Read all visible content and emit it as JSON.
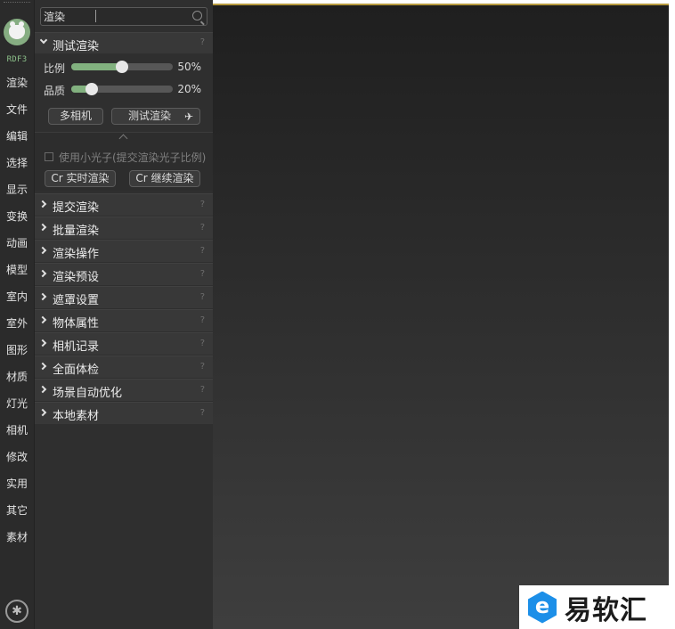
{
  "nav": {
    "version": "RDF3",
    "items": [
      "渲染",
      "文件",
      "编辑",
      "选择",
      "显示",
      "变换",
      "动画",
      "模型",
      "室内",
      "室外",
      "图形",
      "材质",
      "灯光",
      "相机",
      "修改",
      "实用",
      "其它",
      "素材"
    ]
  },
  "search": {
    "value": "渲染"
  },
  "test_render": {
    "title": "测试渲染",
    "help": "?",
    "ratio": {
      "label": "比例",
      "value": 50,
      "value_text": "50%"
    },
    "quality": {
      "label": "品质",
      "value": 20,
      "value_text": "20%"
    },
    "multi_camera_label": "多相机",
    "test_render_label": "测试渲染",
    "small_photon_label": "使用小光子(提交渲染光子比例)",
    "cr_realtime_label": "Cr 实时渲染",
    "cr_continue_label": "Cr 继续渲染"
  },
  "sections": [
    {
      "title": "提交渲染",
      "help": "?"
    },
    {
      "title": "批量渲染",
      "help": "?"
    },
    {
      "title": "渲染操作",
      "help": "?"
    },
    {
      "title": "渲染预设",
      "help": "?"
    },
    {
      "title": "遮罩设置",
      "help": "?"
    },
    {
      "title": "物体属性",
      "help": "?"
    },
    {
      "title": "相机记录",
      "help": "?"
    },
    {
      "title": "全面体检",
      "help": "?"
    },
    {
      "title": "场景自动优化",
      "help": "?"
    },
    {
      "title": "本地素材",
      "help": "?"
    }
  ],
  "watermark": {
    "letter": "e",
    "text": "易软汇"
  },
  "colors": {
    "accent_green": "#82b17f",
    "viewport_border": "#b79a3e",
    "watermark_blue": "#1c8fe8"
  }
}
